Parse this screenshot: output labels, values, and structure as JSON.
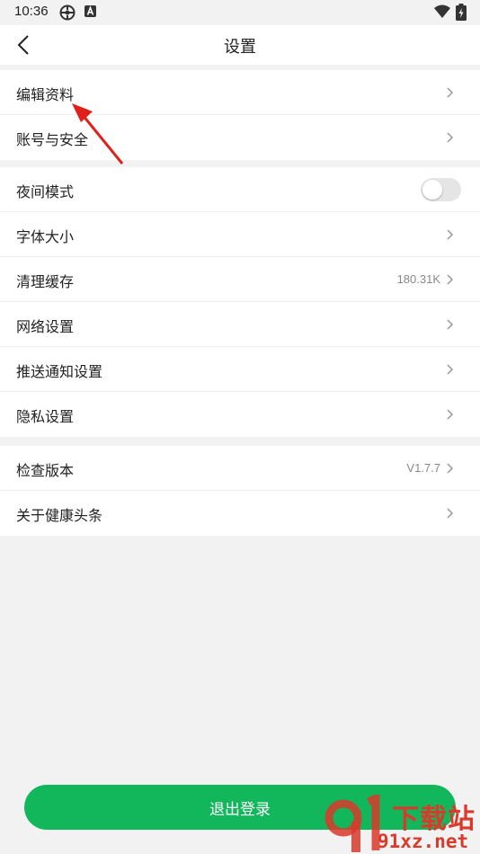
{
  "status_bar": {
    "time": "10:36"
  },
  "header": {
    "title": "设置"
  },
  "groups": [
    {
      "items": [
        {
          "label": "编辑资料"
        },
        {
          "label": "账号与安全"
        }
      ]
    },
    {
      "items": [
        {
          "label": "夜间模式",
          "toggle_on": false
        },
        {
          "label": "字体大小"
        },
        {
          "label": "清理缓存",
          "value": "180.31K"
        },
        {
          "label": "网络设置"
        },
        {
          "label": "推送通知设置"
        },
        {
          "label": "隐私设置"
        }
      ]
    },
    {
      "items": [
        {
          "label": "检查版本",
          "value": "V1.7.7"
        },
        {
          "label": "关于健康头条"
        }
      ]
    }
  ],
  "logout_label": "退出登录",
  "watermark": {
    "top": "下载站",
    "bottom": "91xz.net"
  },
  "colors": {
    "accent": "#12b75b",
    "annotation_arrow": "#e0201a",
    "watermark": "#d93a2b"
  }
}
